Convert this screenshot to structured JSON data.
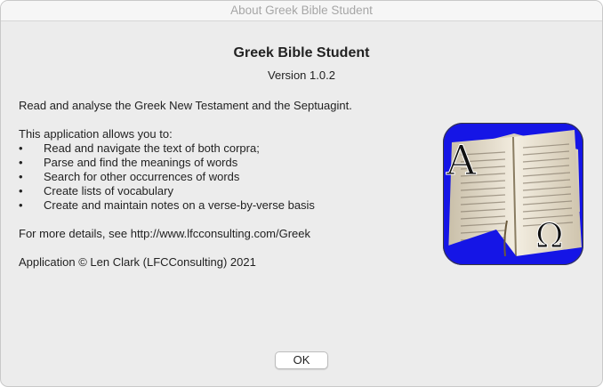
{
  "window": {
    "title": "About Greek Bible Student"
  },
  "about": {
    "app_name": "Greek Bible Student",
    "version": "Version 1.0.2",
    "summary": "Read and analyse the Greek New Testament and the Septuagint.",
    "features_intro": "This application allows you to:",
    "bullet_char": "•",
    "features": [
      "Read and navigate the text of both corpra;",
      "Parse and find the meanings of words",
      "Search for other occurrences of words",
      "Create lists of vocabulary",
      "Create and maintain notes on a verse-by-verse basis"
    ],
    "details": "For more details, see http://www.lfcconsulting.com/Greek",
    "copyright": "Application © Len Clark (LFCConsulting) 2021"
  },
  "icon": {
    "name": "greek-bible-open-book-icon",
    "letter_top": "A",
    "letter_bottom": "Ω",
    "background_color": "#1515e6"
  },
  "buttons": {
    "ok_label": "OK"
  }
}
